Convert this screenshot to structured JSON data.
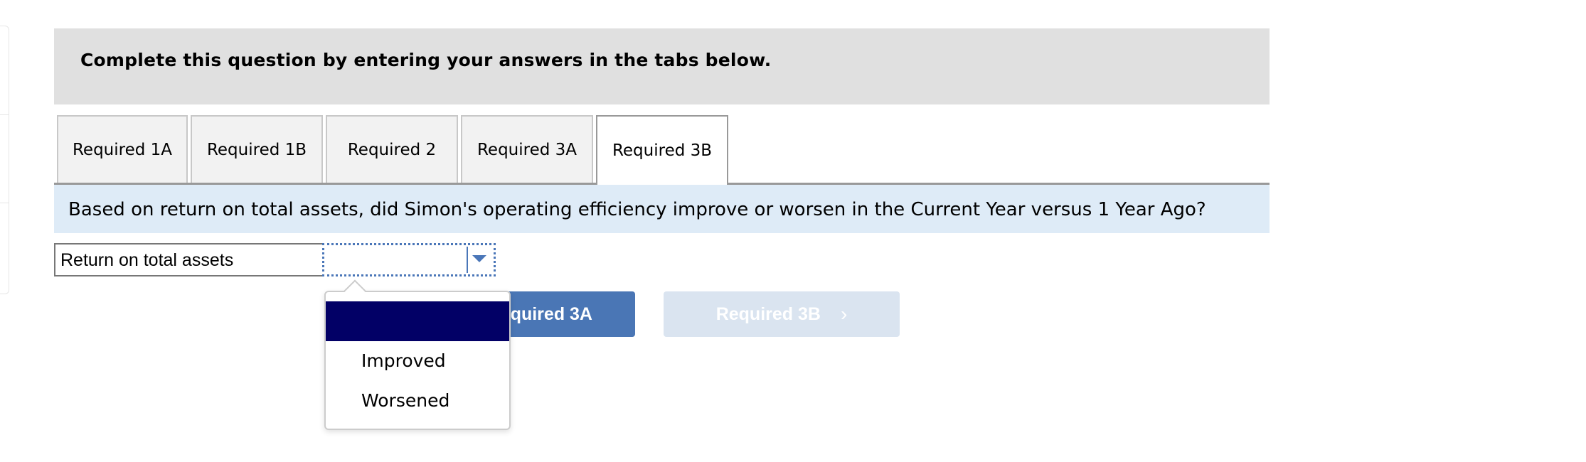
{
  "instructions": {
    "text": "Complete this question by entering your answers in the tabs below."
  },
  "tabs": [
    {
      "label": "Required 1A",
      "active": false
    },
    {
      "label": "Required 1B",
      "active": false
    },
    {
      "label": "Required 2",
      "active": false
    },
    {
      "label": "Required 3A",
      "active": false
    },
    {
      "label": "Required 3B",
      "active": true
    }
  ],
  "prompt": {
    "text": "Based on return on total assets, did Simon's operating efficiency improve or worsen in the Current Year versus 1 Year Ago?"
  },
  "answer": {
    "label": "Return on total assets",
    "selected_value": "",
    "options": [
      "",
      "Improved",
      "Worsened"
    ],
    "highlighted_option_index": 0
  },
  "navigation": {
    "prev_label": "Required 3A",
    "next_label": "Required 3B",
    "next_chevron": "›",
    "next_enabled": false
  },
  "colors": {
    "header_bg": "#e0e0e0",
    "prompt_bg": "#deebf7",
    "focus_blue": "#4a76b8",
    "option_highlight": "#020066",
    "next_disabled_bg": "#dae4f0"
  }
}
